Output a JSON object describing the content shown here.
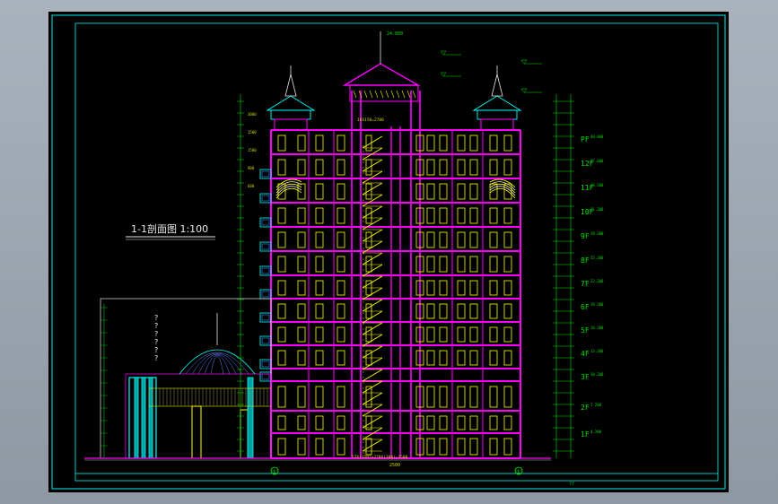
{
  "drawing": {
    "title": "1-1剖面图  1:100",
    "axis_left": "①",
    "axis_right": "①",
    "bottom_dim": "2500",
    "stair_bottom": "57X(150)+270X(300)=1500",
    "stair_top": "18X150=2700",
    "roof_elev": "24.800",
    "annex_marks": [
      "?",
      "?",
      "?",
      "?",
      "?",
      "?"
    ],
    "floor_labels": [
      "PF",
      "12F",
      "11F",
      "10F",
      "9F",
      "8F",
      "7F",
      "6F",
      "5F",
      "4F",
      "3F",
      "2F",
      "1F"
    ],
    "floor_elevs": [
      "40.800",
      "37.600",
      "34.500",
      "31.200",
      "28.200",
      "25.200",
      "22.200",
      "19.200",
      "16.200",
      "13.200",
      "10.200",
      "7.200",
      "4.200"
    ],
    "small_dims": [
      "3000",
      "1500",
      "1500",
      "900",
      "600"
    ],
    "colors": {
      "frame": "#00c8c8",
      "slab": "#ff00ff",
      "window": "#ffff00",
      "dim": "#00e000",
      "rail": "#00ffff",
      "text": "#e8e8e8"
    },
    "scale_mark": "??"
  }
}
